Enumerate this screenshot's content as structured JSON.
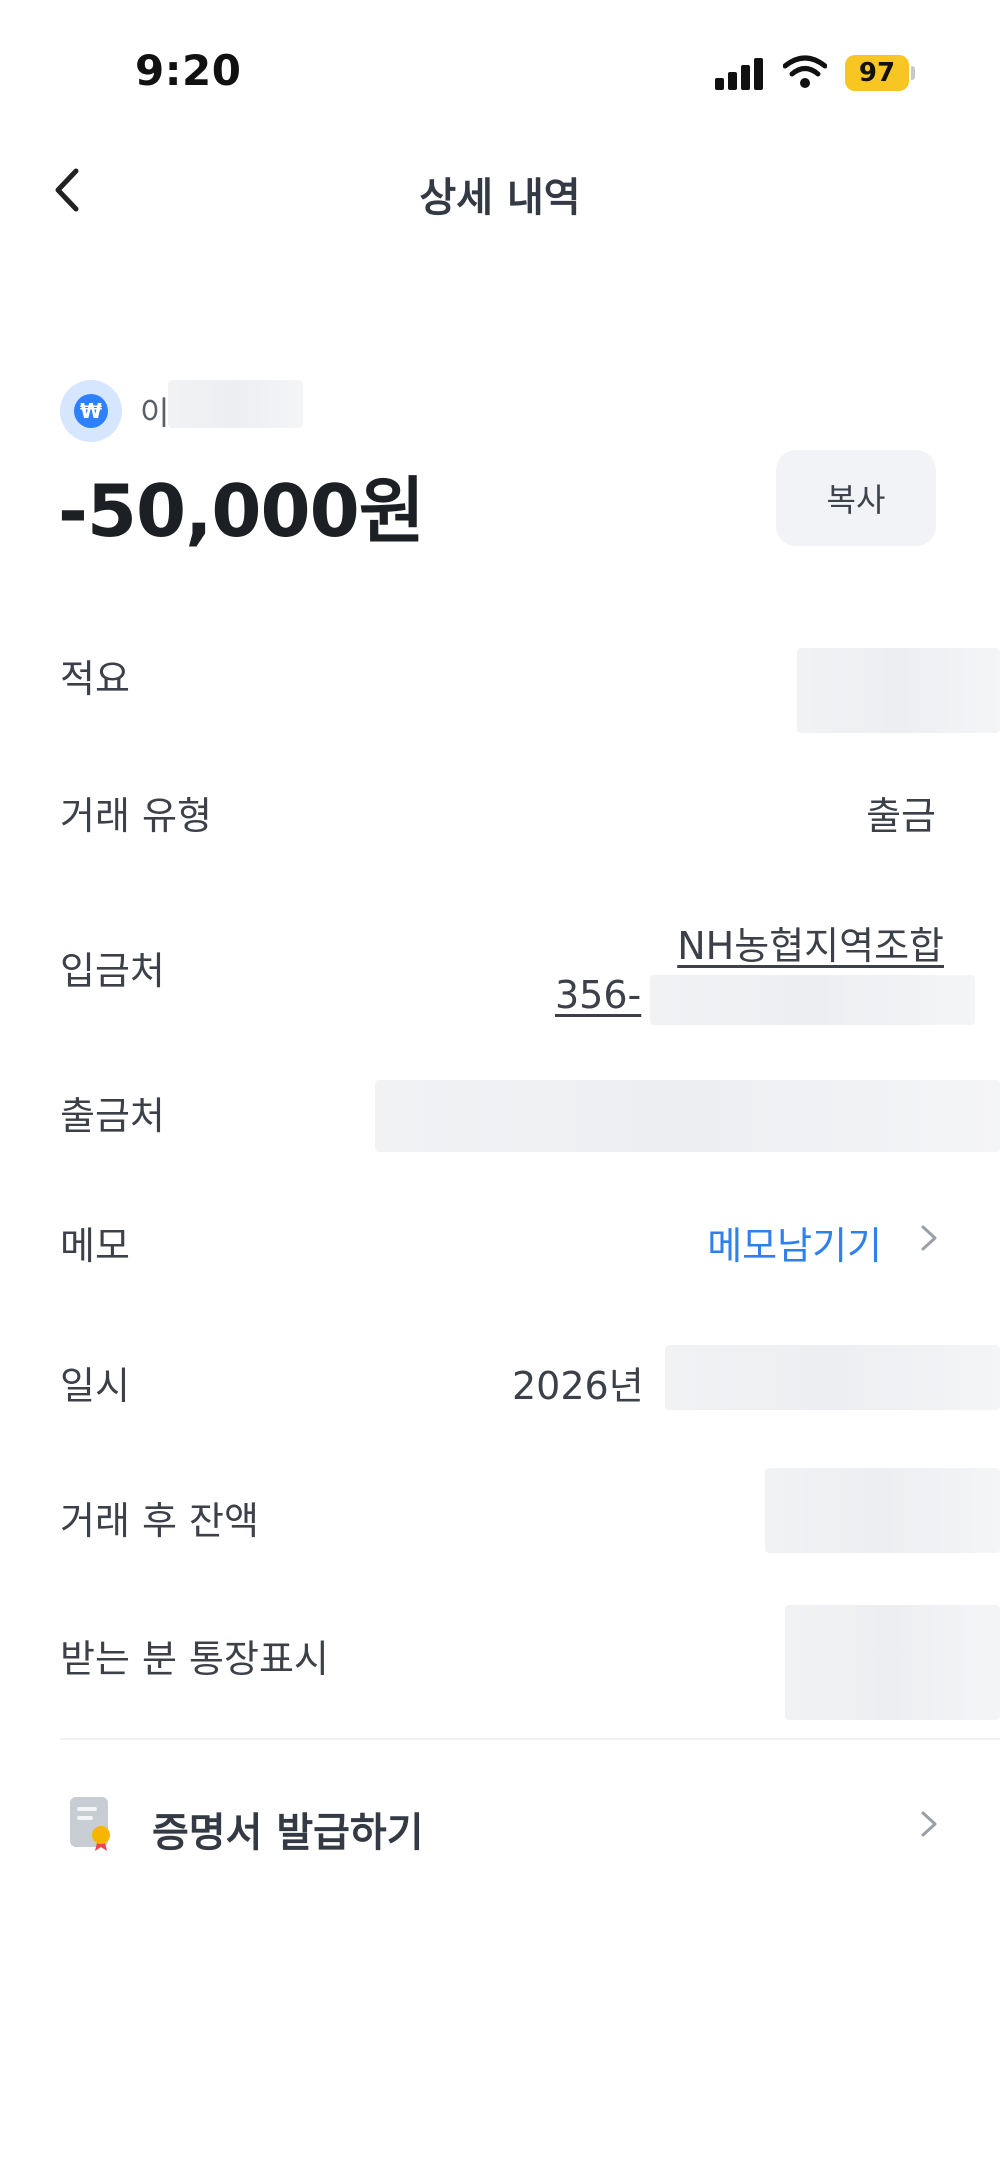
{
  "status_bar": {
    "time": "9:20",
    "battery": "97"
  },
  "header": {
    "title": "상세 내역"
  },
  "account": {
    "name_visible": "이",
    "icon": "won-icon"
  },
  "transaction": {
    "amount": "-50,000원",
    "copy_label": "복사"
  },
  "rows": {
    "memo_summary_label": "적요",
    "type_label": "거래 유형",
    "type_value": "출금",
    "deposit_to_label": "입금처",
    "deposit_to_bank": "NH농협지역조합",
    "deposit_to_account": "356-",
    "withdraw_from_label": "출금처",
    "memo_label": "메모",
    "memo_action": "메모남기기",
    "datetime_label": "일시",
    "datetime_value": "2026년",
    "balance_label": "거래 후 잔액",
    "recipient_display_label": "받는 분 통장표시"
  },
  "certificate": {
    "label": "증명서 발급하기"
  },
  "colors": {
    "accent": "#2f80ed",
    "battery": "#f7c622",
    "won_icon": "#2f80ff"
  }
}
